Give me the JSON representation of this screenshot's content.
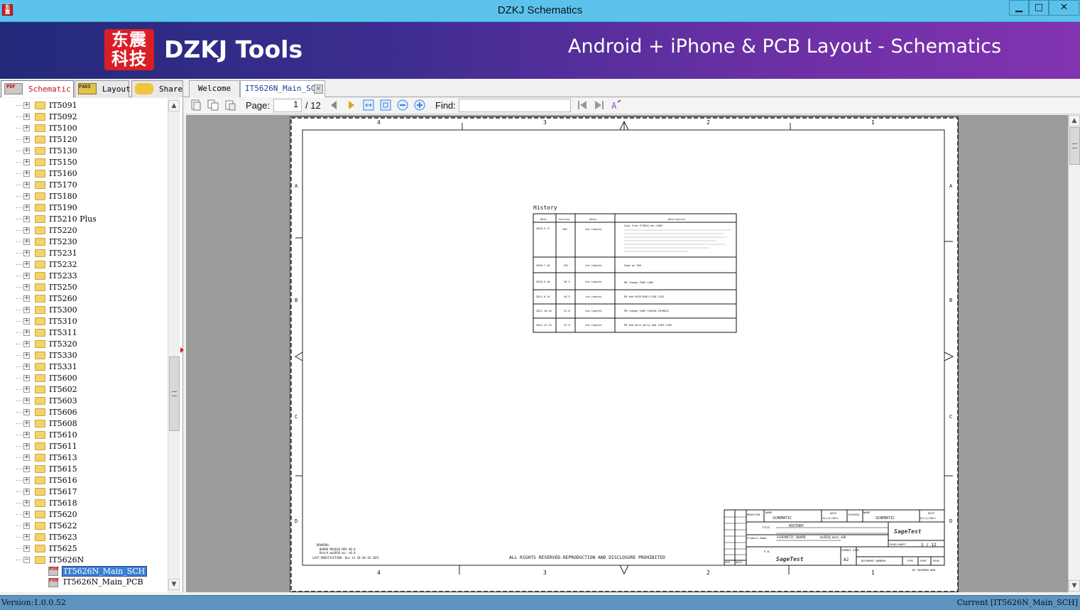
{
  "window": {
    "title": "DZKJ Schematics",
    "minimize": "▁",
    "maximize": "□",
    "close": "✕",
    "app_icon_text": "东震"
  },
  "banner": {
    "logo_text": "东震\n科技",
    "brand": "DZKJ Tools",
    "tagline": "Android + iPhone & PCB Layout - Schematics"
  },
  "left_tabs": [
    {
      "label": "Schematic",
      "icon": "pdf-icon",
      "active": true
    },
    {
      "label": "Layout",
      "icon": "pads-icon",
      "active": false
    },
    {
      "label": "Share",
      "icon": "share-icon",
      "active": false
    }
  ],
  "doc_tabs": [
    {
      "label": "Welcome",
      "active": false
    },
    {
      "label": "IT5626N_Main_SCH",
      "active": true
    }
  ],
  "tree": {
    "folders": [
      "IT5091",
      "IT5092",
      "IT5100",
      "IT5120",
      "IT5130",
      "IT5150",
      "IT5160",
      "IT5170",
      "IT5180",
      "IT5190",
      "IT5210 Plus",
      "IT5220",
      "IT5230",
      "IT5231",
      "IT5232",
      "IT5233",
      "IT5250",
      "IT5260",
      "IT5300",
      "IT5310",
      "IT5311",
      "IT5320",
      "IT5330",
      "IT5331",
      "IT5600",
      "IT5602",
      "IT5603",
      "IT5606",
      "IT5608",
      "IT5610",
      "IT5611",
      "IT5613",
      "IT5615",
      "IT5616",
      "IT5617",
      "IT5618",
      "IT5620",
      "IT5622",
      "IT5623",
      "IT5625",
      "IT5626N"
    ],
    "expanded_children": [
      {
        "label": "IT5626N_Main_SCH",
        "selected": true
      },
      {
        "label": "IT5626N_Main_PCB",
        "selected": false
      }
    ]
  },
  "toolbar": {
    "page_label": "Page:",
    "page_value": "1",
    "page_total": "/ 12",
    "find_label": "Find:",
    "find_value": ""
  },
  "schematic": {
    "history_title": "History",
    "history_headers": [
      "Date",
      "Version",
      "Owner",
      "Description"
    ],
    "history_rows": [
      {
        "date": "2020-5-17",
        "version": "V00",
        "owner": "Jim Langfei",
        "desc": "Copy from IT5626_Ver_V003"
      },
      {
        "date": "2020-7-10",
        "version": "V01",
        "owner": "Jim Langfei",
        "desc": "Same as V00"
      },
      {
        "date": "2020-9-10",
        "version": "V0.5",
        "owner": "Jim Langfei",
        "desc": "PB Change P403-L003"
      },
      {
        "date": "2021-6-14",
        "version": "V0.9",
        "owner": "Jim Langfei",
        "desc": "PB Add R359.R363.C348.C342"
      },
      {
        "date": "2021-10-20",
        "version": "V1.0",
        "owner": "Jim Langfei",
        "desc": "PB Change L003 P403S0-1R7HDSS"
      },
      {
        "date": "2021-12-13",
        "version": "V1.0",
        "owner": "Jim Langfei",
        "desc": "PB Add more parts.add C383.C365"
      }
    ],
    "col_top": [
      "4",
      "3",
      "2",
      "1"
    ],
    "col_bottom": [
      "4",
      "3",
      "2",
      "1"
    ],
    "rows": [
      "A",
      "B",
      "C",
      "D"
    ],
    "footer_notice": "ALL RIGHTS RESERVED.REPRODUCTION AND DISCLOSURE PROHIBITED",
    "drawing_note": [
      "DRAWING:",
      "BOARD MA3810 REV V0.0",
      "Board ma3810 ms: v0.0",
      "LAST_MODIFICATION: Dec 13 18:38:18 2021"
    ],
    "title_block": {
      "name_label": "NAME",
      "name_value": "SCHEMATIC",
      "date_label": "DATE",
      "date_value": "15/11/2021",
      "checked_label": "CHECKED",
      "checked_name": "SCHEMATIC",
      "checked_date": "15/11/2021",
      "title_label": "TITLE",
      "title_value": "HISTORY",
      "product_label": "Product Name",
      "product_value": "SCHEMATIC BOARD",
      "product_value2": "ma3810_main_v00",
      "pn_label": "P.N.",
      "format_label": "FORMAT SIZE",
      "format_value": "A2",
      "page_label": "PAGE/SHEET",
      "page_value": "1 / 12",
      "doc_number_label": "DOCUMENT NUMBER",
      "type_label": "TYPE",
      "part_label": "PART",
      "vers_label": "VERS",
      "logo": "SageTest",
      "modified_label": "MODIFIED",
      "ver_label": "VER",
      "date_short": "DATE",
      "author": "BY INIMANO WOB"
    }
  },
  "status": {
    "version": "Version:1.0.0.52",
    "current": "Current [IT5626N_Main_SCH]"
  }
}
